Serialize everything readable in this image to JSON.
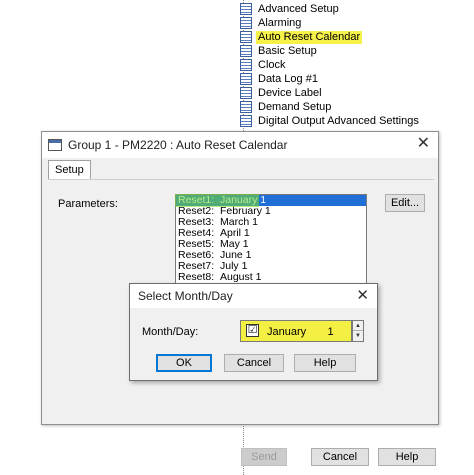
{
  "tree": {
    "items": [
      {
        "label": "Advanced Setup",
        "highlighted": false
      },
      {
        "label": "Alarming",
        "highlighted": false
      },
      {
        "label": "Auto Reset Calendar",
        "highlighted": true
      },
      {
        "label": "Basic Setup",
        "highlighted": false
      },
      {
        "label": "Clock",
        "highlighted": false
      },
      {
        "label": "Data Log #1",
        "highlighted": false
      },
      {
        "label": "Device Label",
        "highlighted": false
      },
      {
        "label": "Demand Setup",
        "highlighted": false
      },
      {
        "label": "Digital Output Advanced Settings",
        "highlighted": false
      }
    ]
  },
  "dialog": {
    "title": "Group 1 - PM2220 : Auto Reset Calendar",
    "close": "✕",
    "tab": "Setup",
    "parameters_label": "Parameters:",
    "edit_button": "Edit...",
    "send_button": "Send",
    "cancel_button": "Cancel",
    "help_button": "Help",
    "list": [
      {
        "key": "Reset1:",
        "value": "January 1",
        "selected": true
      },
      {
        "key": "Reset2:",
        "value": "February 1",
        "selected": false
      },
      {
        "key": "Reset3:",
        "value": "March 1",
        "selected": false
      },
      {
        "key": "Reset4:",
        "value": "April 1",
        "selected": false
      },
      {
        "key": "Reset5:",
        "value": "May 1",
        "selected": false
      },
      {
        "key": "Reset6:",
        "value": "June 1",
        "selected": false
      },
      {
        "key": "Reset7:",
        "value": "July 1",
        "selected": false
      },
      {
        "key": "Reset8:",
        "value": "August 1",
        "selected": false
      }
    ]
  },
  "subdialog": {
    "title": "Select Month/Day",
    "close": "✕",
    "label": "Month/Day:",
    "checkbox_mark": "☑",
    "month": "January",
    "day": "1",
    "ok_button": "OK",
    "cancel_button": "Cancel",
    "help_button": "Help"
  },
  "colors": {
    "highlight_yellow": "#f6f24a",
    "selection_blue": "#1f6fd6",
    "highlight_green": "#78dc28"
  }
}
